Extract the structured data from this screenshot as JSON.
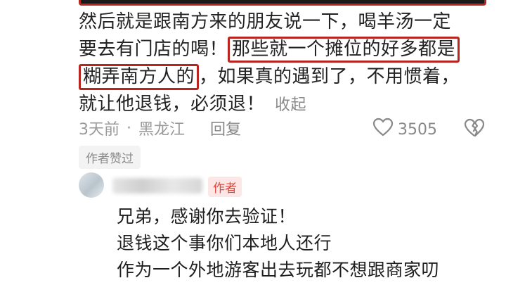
{
  "comment": {
    "lines": [
      [
        "然后就是跟南方来的朋友说一下，喝羊汤一定"
      ],
      [
        "要去有门店的喝！",
        "那些就一个摊位的好多都是"
      ],
      [
        "糊弄南方人的",
        "，如果真的遇到了，不用惯着，"
      ],
      [
        "就让他退钱，必须退！"
      ]
    ],
    "collapse_label": "收起",
    "time": "3天前",
    "separator": "·",
    "location": "黑龙江",
    "reply_label": "回复",
    "like_count": "3505",
    "author_liked_label": "作者赞过"
  },
  "reply": {
    "author_badge": "作者",
    "lines": [
      "兄弟，感谢你去验证！",
      "退钱这个事你们本地人还行",
      "作为一个外地游客出去玩都不想跟商家叨"
    ]
  },
  "colors": {
    "highlight_border": "#b8251f",
    "author_badge_bg": "#fde6e6",
    "author_badge_text": "#e0473a",
    "meta_text": "#999999"
  },
  "icons": {
    "like": "heart-outline-icon",
    "dislike": "broken-heart-icon"
  }
}
